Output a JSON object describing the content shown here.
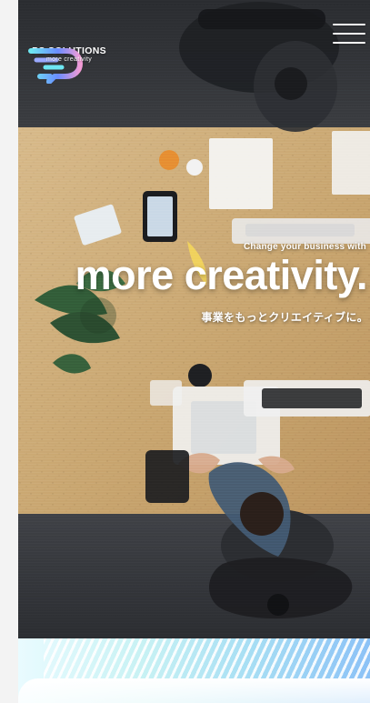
{
  "brand": {
    "name": "PS SOLUTIONS",
    "tagline": "more creativity",
    "colors": {
      "accent_cyan": "#6ee7f2",
      "accent_blue": "#6a8cff",
      "accent_pink": "#f29bd6"
    }
  },
  "nav": {
    "menu_icon": "hamburger-menu-icon"
  },
  "hero": {
    "kicker": "Change your business with",
    "headline": "more creativity.",
    "subheadline_jp": "事業をもっとクリエイティブに。"
  }
}
